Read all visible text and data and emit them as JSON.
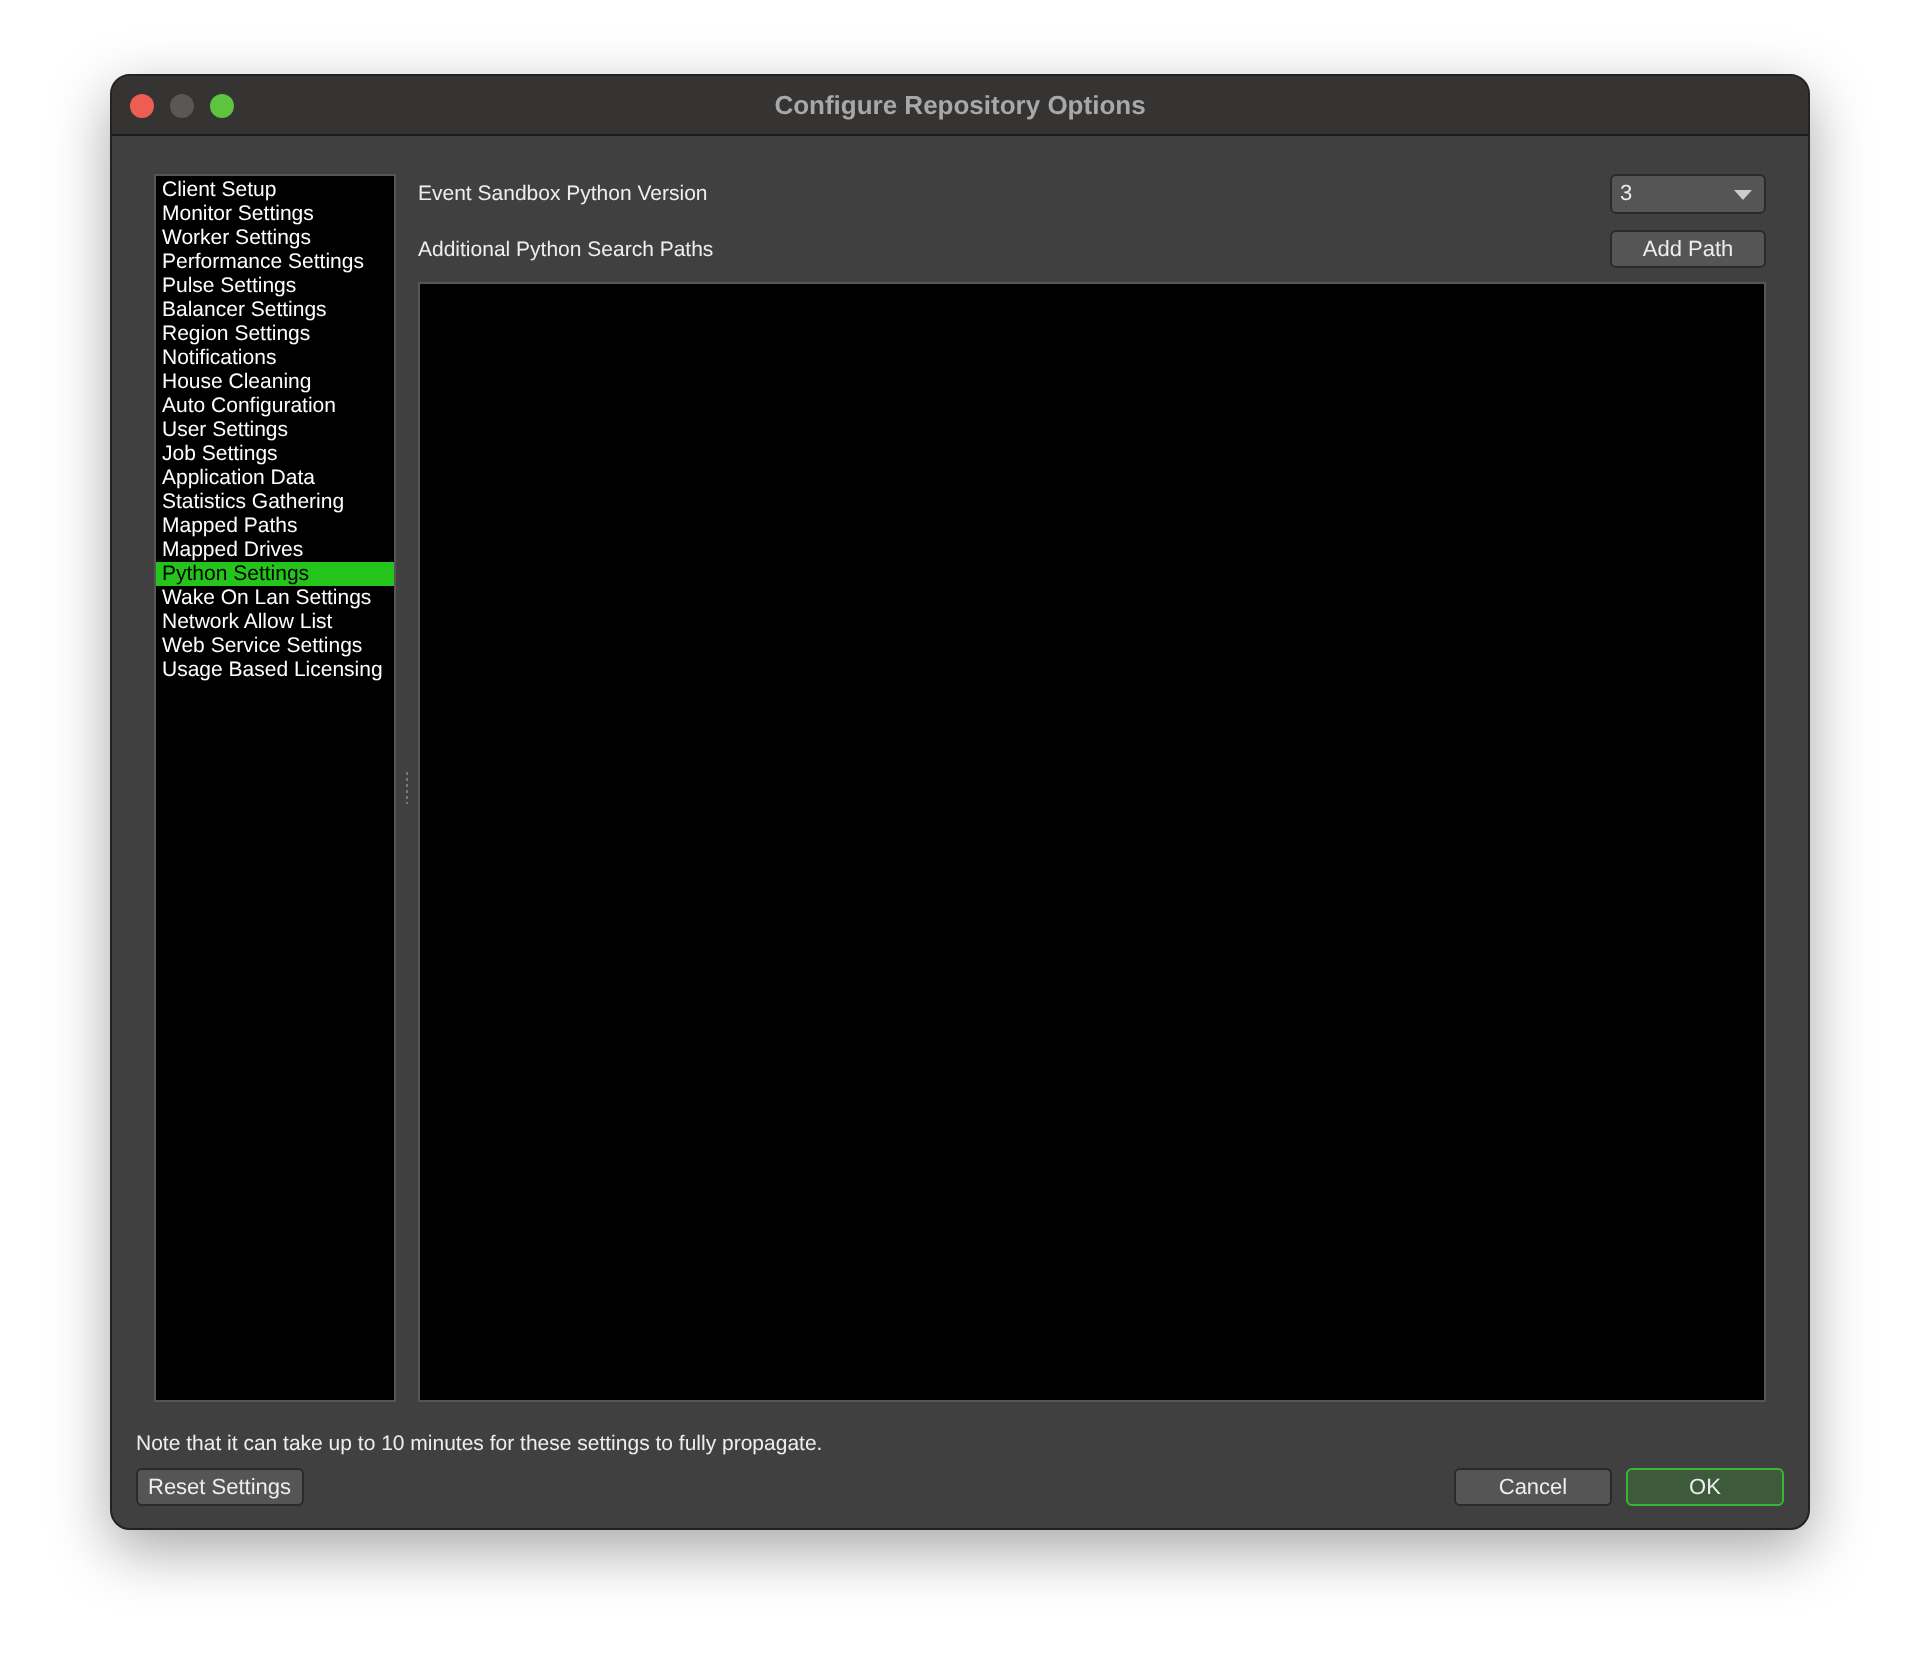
{
  "window": {
    "title": "Configure Repository Options"
  },
  "sidebar": {
    "items": [
      {
        "label": "Client Setup",
        "selected": false
      },
      {
        "label": "Monitor Settings",
        "selected": false
      },
      {
        "label": "Worker Settings",
        "selected": false
      },
      {
        "label": "Performance Settings",
        "selected": false
      },
      {
        "label": "Pulse Settings",
        "selected": false
      },
      {
        "label": "Balancer Settings",
        "selected": false
      },
      {
        "label": "Region Settings",
        "selected": false
      },
      {
        "label": "Notifications",
        "selected": false
      },
      {
        "label": "House Cleaning",
        "selected": false
      },
      {
        "label": "Auto Configuration",
        "selected": false
      },
      {
        "label": "User Settings",
        "selected": false
      },
      {
        "label": "Job Settings",
        "selected": false
      },
      {
        "label": "Application Data",
        "selected": false
      },
      {
        "label": "Statistics Gathering",
        "selected": false
      },
      {
        "label": "Mapped Paths",
        "selected": false
      },
      {
        "label": "Mapped Drives",
        "selected": false
      },
      {
        "label": "Python Settings",
        "selected": true
      },
      {
        "label": "Wake On Lan Settings",
        "selected": false
      },
      {
        "label": "Network Allow List",
        "selected": false
      },
      {
        "label": "Web Service Settings",
        "selected": false
      },
      {
        "label": "Usage Based Licensing",
        "selected": false
      }
    ]
  },
  "python_version": {
    "label": "Event Sandbox Python Version",
    "value": "3"
  },
  "search_paths": {
    "label": "Additional Python Search Paths",
    "button": "Add Path"
  },
  "note": "Note that it can take up to 10 minutes for these settings to fully propagate.",
  "buttons": {
    "reset": "Reset Settings",
    "cancel": "Cancel",
    "ok": "OK"
  }
}
